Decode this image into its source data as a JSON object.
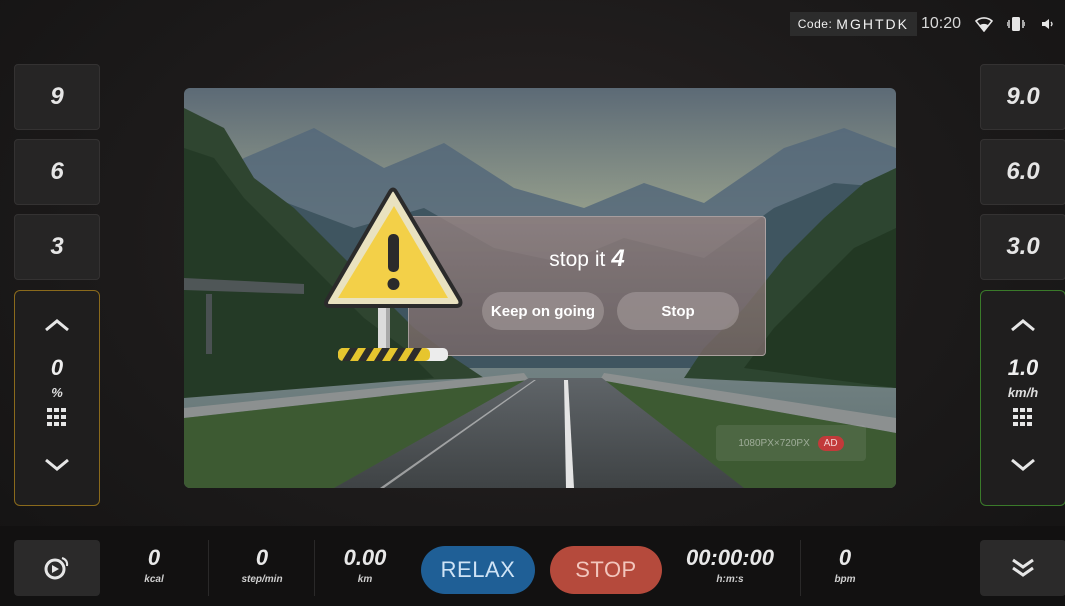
{
  "status": {
    "code_label": "Code:",
    "code_value": "MGHTDK",
    "time": "10:20",
    "icons": [
      "wifi-icon",
      "vibrate-icon",
      "volume-icon"
    ]
  },
  "incline": {
    "presets": [
      "9",
      "6",
      "3"
    ],
    "value": "0",
    "unit": "%",
    "accent": "#8a6a1c"
  },
  "speed": {
    "presets": [
      "9.0",
      "6.0",
      "3.0"
    ],
    "value": "1.0",
    "unit": "km/h",
    "accent": "#3a7a2a"
  },
  "video": {
    "ad_text": "1080PX×720PX",
    "ad_label": "AD"
  },
  "dialog": {
    "title": "stop it",
    "countdown": "4",
    "keep_label": "Keep on going",
    "stop_label": "Stop"
  },
  "bottom": {
    "calories": {
      "value": "0",
      "unit": "kcal"
    },
    "cadence": {
      "value": "0",
      "unit": "step/min"
    },
    "distance": {
      "value": "0.00",
      "unit": "km"
    },
    "relax_label": "RELAX",
    "stop_label": "STOP",
    "time": {
      "value": "00:00:00",
      "unit": "h:m:s"
    },
    "heart": {
      "value": "0",
      "unit": "bpm"
    }
  },
  "colors": {
    "relax": "#1f5f96",
    "stop": "#b54a3c",
    "warning": "#f3d048"
  }
}
